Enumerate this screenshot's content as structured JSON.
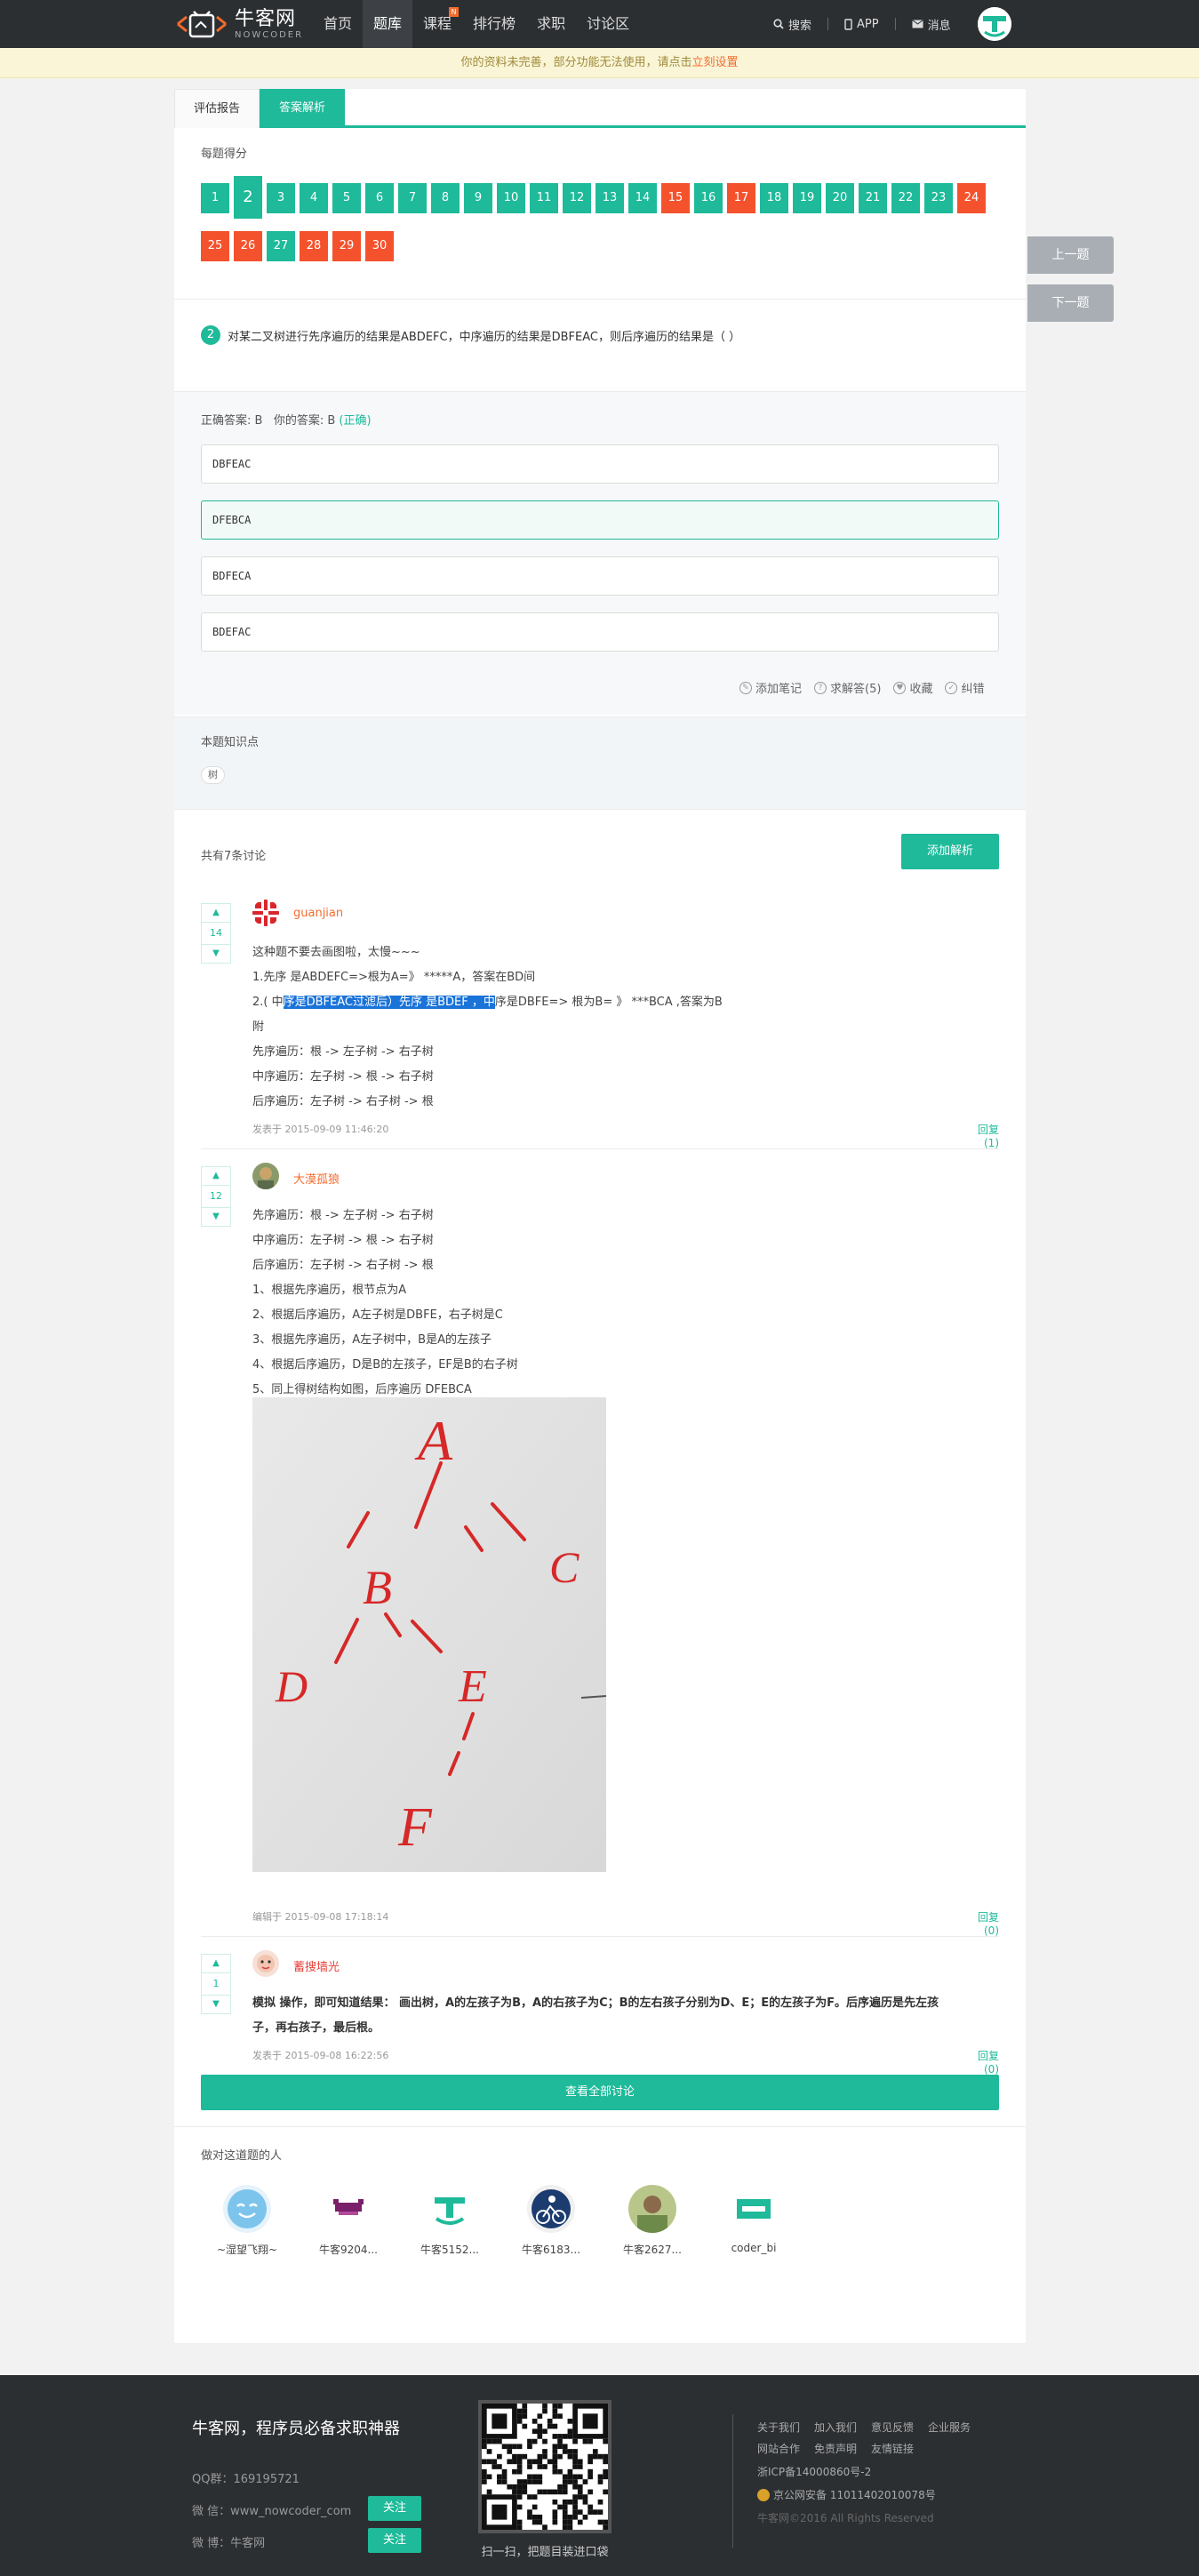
{
  "nav": {
    "logo_cn": "牛客网",
    "logo_en": "NOWCODER",
    "items": [
      "首页",
      "题库",
      "课程",
      "排行榜",
      "求职",
      "讨论区"
    ],
    "active": "题库",
    "new_badge": "N",
    "search": "搜索",
    "app": "APP",
    "messages": "消息"
  },
  "notice": {
    "text": "你的资料未完善，部分功能无法使用，请点击",
    "link": "立刻设置"
  },
  "tabs": [
    "评估报告",
    "答案解析"
  ],
  "score": {
    "title": "每题得分",
    "current": 2,
    "items": [
      {
        "n": "1",
        "s": "g"
      },
      {
        "n": "2",
        "s": "g"
      },
      {
        "n": "3",
        "s": "g"
      },
      {
        "n": "4",
        "s": "g"
      },
      {
        "n": "5",
        "s": "g"
      },
      {
        "n": "6",
        "s": "g"
      },
      {
        "n": "7",
        "s": "g"
      },
      {
        "n": "8",
        "s": "g"
      },
      {
        "n": "9",
        "s": "g"
      },
      {
        "n": "10",
        "s": "g"
      },
      {
        "n": "11",
        "s": "g"
      },
      {
        "n": "12",
        "s": "g"
      },
      {
        "n": "13",
        "s": "g"
      },
      {
        "n": "14",
        "s": "g"
      },
      {
        "n": "15",
        "s": "r"
      },
      {
        "n": "16",
        "s": "g"
      },
      {
        "n": "17",
        "s": "r"
      },
      {
        "n": "18",
        "s": "g"
      },
      {
        "n": "19",
        "s": "g"
      },
      {
        "n": "20",
        "s": "g"
      },
      {
        "n": "21",
        "s": "g"
      },
      {
        "n": "22",
        "s": "g"
      },
      {
        "n": "23",
        "s": "g"
      },
      {
        "n": "24",
        "s": "r"
      },
      {
        "n": "25",
        "s": "r"
      },
      {
        "n": "26",
        "s": "r"
      },
      {
        "n": "27",
        "s": "g"
      },
      {
        "n": "28",
        "s": "r"
      },
      {
        "n": "29",
        "s": "r"
      },
      {
        "n": "30",
        "s": "r"
      }
    ]
  },
  "question": {
    "number": "2",
    "text": "对某二叉树进行先序遍历的结果是ABDEFC，中序遍历的结果是DBFEAC，则后序遍历的结果是（ ）"
  },
  "answer": {
    "correct_label": "正确答案: B",
    "yours_label": "你的答案: B",
    "status": "(正确)",
    "options": [
      "DBFEAC",
      "DFEBCA",
      "BDFECA",
      "BDEFAC"
    ],
    "selected_index": 1
  },
  "actions": [
    "添加笔记",
    "求解答(5)",
    "收藏",
    "纠错"
  ],
  "knowledge": {
    "title": "本题知识点",
    "tag": "树"
  },
  "discussion": {
    "count": "共有7条讨论",
    "add_button": "添加解析",
    "view_all": "查看全部讨论",
    "c1": {
      "votes": "14",
      "user": "guanjian",
      "l1": "这种题不要去画图啦，太慢~~~",
      "l2": "1.先序 是ABDEFC=>根为A=》 *****A，答案在BD间",
      "l3a": "2.( 中",
      "l3b": "序是DBFEAC过滤后）先序 是BDEF ，中",
      "l3c": "序是DBFE=> 根为B= 》 ***BCA ,答案为B",
      "l4": "附",
      "l5": "先序遍历：根 -> 左子树 -> 右子树",
      "l6": "中序遍历：左子树 -> 根 -> 右子树",
      "l7": "后序遍历：左子树 -> 右子树 -> 根",
      "meta": "发表于 2015-09-09 11:46:20",
      "reply": "回复(1)"
    },
    "c2": {
      "votes": "12",
      "user": "大漠孤狼",
      "l1": "先序遍历：根 -> 左子树 -> 右子树",
      "l2": "中序遍历：左子树 -> 根 -> 右子树",
      "l3": "后序遍历：左子树 -> 右子树 -> 根",
      "l4": "1、根据先序遍历，根节点为A",
      "l5": "2、根据后序遍历，A左子树是DBFE，右子树是C",
      "l6": "3、根据先序遍历，A左子树中，B是A的左孩子",
      "l7": "4、根据后序遍历，D是B的左孩子，EF是B的右子树",
      "l8": "5、同上得树结构如图，后序遍历 DFEBCA",
      "tree_nodes": [
        "A",
        "B",
        "C",
        "D",
        "E",
        "F"
      ],
      "meta": "编辑于 2015-09-08 17:18:14",
      "reply": "回复(0)"
    },
    "c3": {
      "votes": "1",
      "user": "蓄搜墙光",
      "l1": "模拟 操作，即可知道结果： 画出树，A的左孩子为B，A的右孩子为C；B的左右孩子分别为D、E；E的左孩子为F。后序遍历是先左孩",
      "l2": "子，再右孩子，最后根。",
      "meta": "发表于 2015-09-08 16:22:56",
      "reply": "回复(0)"
    }
  },
  "solvers": {
    "title": "做对这道题的人",
    "users": [
      "~湿望飞翔~",
      "牛客9204...",
      "牛客5152...",
      "牛客6183...",
      "牛客2627...",
      "coder_bi"
    ]
  },
  "side": {
    "prev": "上一题",
    "next": "下一题"
  },
  "footer": {
    "slogan": "牛客网，程序员必备求职神器",
    "qq": "QQ群：169195721",
    "wechat": "微 信：www_nowcoder_com",
    "weibo": "微 博：牛客网",
    "follow": "关注",
    "qr_caption": "扫一扫，把题目装进口袋",
    "links1": [
      "关于我们",
      "加入我们",
      "意见反馈",
      "企业服务"
    ],
    "links2": [
      "网站合作",
      "免责声明",
      "友情链接"
    ],
    "icp": "浙ICP备14000860号-2",
    "police": "京公网安备 11011402010078号",
    "copyright": "牛客网©2016 All Rights Reserved"
  },
  "colors": {
    "accent": "#1eba9a",
    "wrong": "#f4522d",
    "username": "#f46b2e",
    "dark": "#2c2f32"
  }
}
